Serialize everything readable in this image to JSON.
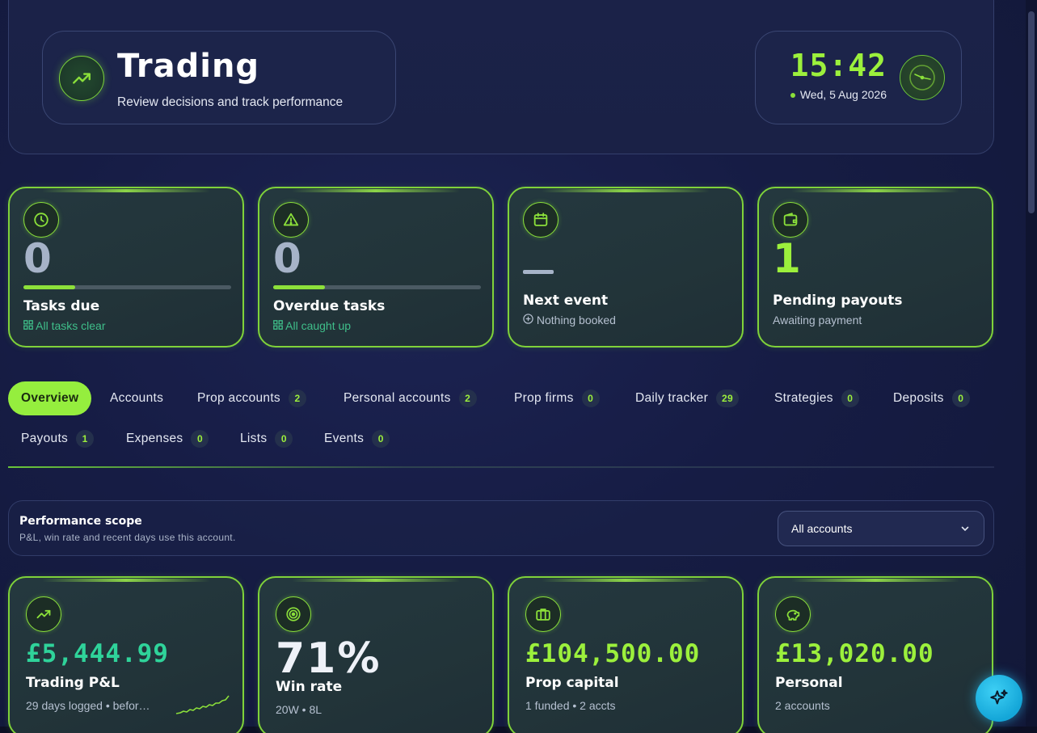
{
  "header": {
    "title": "Trading",
    "subtitle": "Review decisions and track performance",
    "clock_time": "15:42",
    "clock_date": "Wed, 5 Aug 2026"
  },
  "stats": [
    {
      "value": "0",
      "label": "Tasks due",
      "sub": "All tasks clear",
      "progress": 0.25,
      "icon": "clock-icon"
    },
    {
      "value": "0",
      "label": "Overdue tasks",
      "sub": "All caught up",
      "progress": 0.25,
      "icon": "alert-triangle-icon"
    },
    {
      "value": "—",
      "label": "Next event",
      "sub": "Nothing booked",
      "icon": "calendar-icon"
    },
    {
      "value": "1",
      "label": "Pending payouts",
      "sub": "Awaiting payment",
      "icon": "wallet-icon"
    }
  ],
  "tabs": [
    {
      "label": "Overview",
      "badge": ""
    },
    {
      "label": "Accounts",
      "badge": ""
    },
    {
      "label": "Prop accounts",
      "badge": "2"
    },
    {
      "label": "Personal accounts",
      "badge": "2"
    },
    {
      "label": "Prop firms",
      "badge": "0"
    },
    {
      "label": "Daily tracker",
      "badge": "29"
    },
    {
      "label": "Strategies",
      "badge": "0"
    },
    {
      "label": "Deposits",
      "badge": "0"
    },
    {
      "label": "Payouts",
      "badge": "1"
    },
    {
      "label": "Expenses",
      "badge": "0"
    },
    {
      "label": "Lists",
      "badge": "0"
    },
    {
      "label": "Events",
      "badge": "0"
    }
  ],
  "scope": {
    "title": "Performance scope",
    "description": "P&L, win rate and recent days use this account.",
    "selected": "All accounts"
  },
  "metrics": [
    {
      "value": "£5,444.99",
      "label": "Trading P&L",
      "sub": "29 days logged • befor…",
      "icon": "trending-up-icon"
    },
    {
      "value": "71%",
      "label": "Win rate",
      "sub": "20W • 8L",
      "icon": "target-icon"
    },
    {
      "value": "£104,500.00",
      "label": "Prop capital",
      "sub": "1 funded • 2 accts",
      "icon": "briefcase-icon"
    },
    {
      "value": "£13,020.00",
      "label": "Personal",
      "sub": "2 accounts",
      "icon": "piggy-bank-icon"
    }
  ],
  "colors": {
    "accent": "#95ee3e",
    "teal": "#2fd39a",
    "background": "#161c44"
  }
}
